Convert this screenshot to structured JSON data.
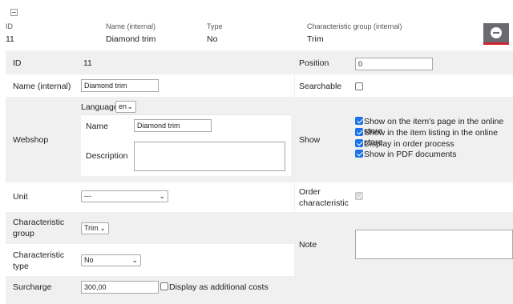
{
  "summary": {
    "headers": [
      "ID",
      "Name (internal)",
      "Type",
      "Characteristic group (internal)"
    ],
    "values": [
      "11",
      "Diamond trim",
      "No",
      "Trim"
    ]
  },
  "form": {
    "id": {
      "label": "ID",
      "value": "11"
    },
    "position": {
      "label": "Position",
      "value": "0"
    },
    "name_internal": {
      "label": "Name (internal)",
      "value": "Diamond trim"
    },
    "searchable": {
      "label": "Searchable",
      "checked": false
    },
    "webshop": {
      "label": "Webshop",
      "language_label": "Language",
      "language_value": "en",
      "name_label": "Name",
      "name_value": "Diamond trim",
      "description_label": "Description",
      "description_value": ""
    },
    "show": {
      "label": "Show",
      "options": [
        {
          "label": "Show on the item's page in the online store",
          "checked": true
        },
        {
          "label": "Show in the item listing in the online store",
          "checked": true
        },
        {
          "label": "Display in order process",
          "checked": true
        },
        {
          "label": "Show in PDF documents",
          "checked": true
        }
      ]
    },
    "unit": {
      "label": "Unit",
      "value": "---"
    },
    "order_characteristic": {
      "label_line1": "Order",
      "label_line2": "characteristic",
      "checked": true,
      "disabled": true
    },
    "characteristic_group": {
      "label_line1": "Characteristic",
      "label_line2": "group",
      "value": "Trim"
    },
    "note": {
      "label": "Note",
      "value": ""
    },
    "characteristic_type": {
      "label_line1": "Characteristic",
      "label_line2": "type",
      "value": "No"
    },
    "surcharge": {
      "label": "Surcharge",
      "value": "300,00",
      "additional_label": "Display as additional costs",
      "additional_checked": false
    }
  },
  "colors": {
    "accent": "#d32236",
    "checkbox": "#1a73e8",
    "button_bg": "#696b6e"
  }
}
